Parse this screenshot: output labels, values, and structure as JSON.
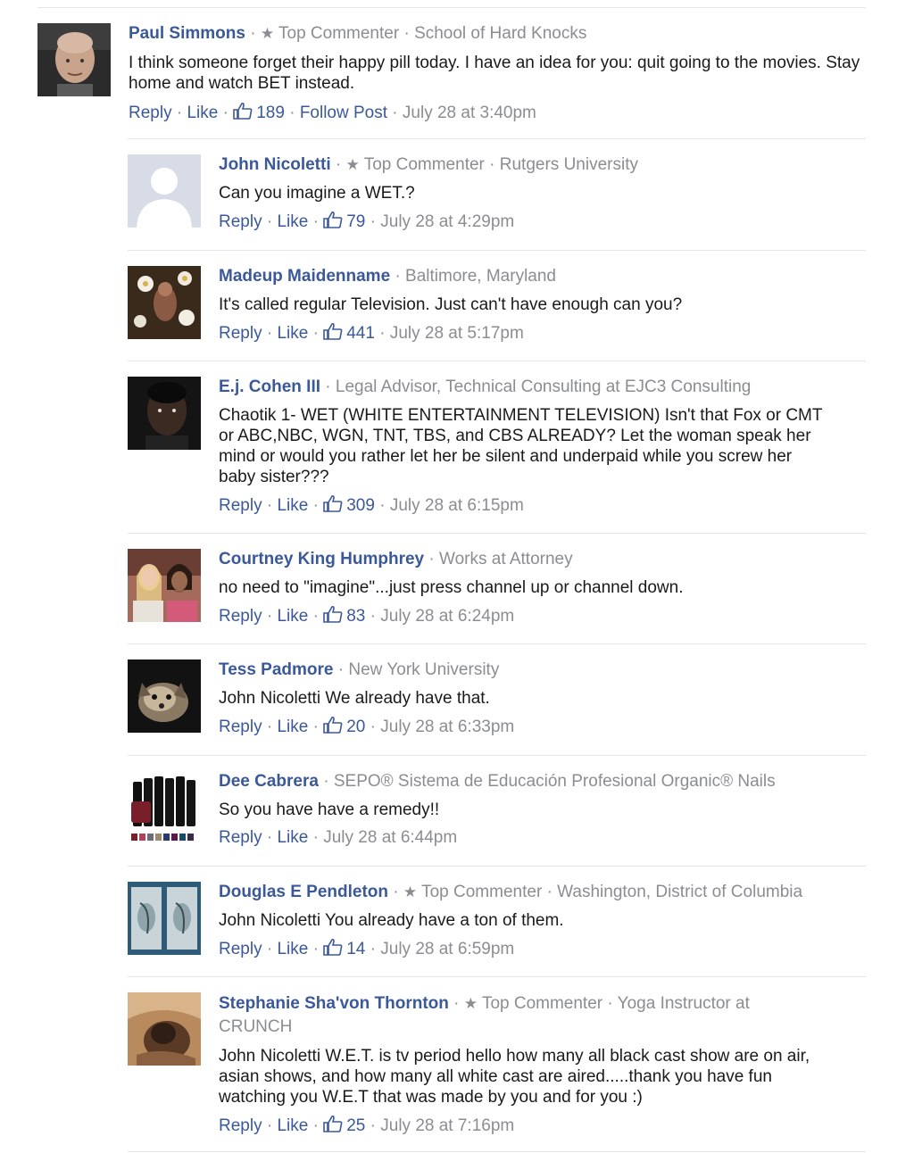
{
  "labels": {
    "reply": "Reply",
    "like": "Like",
    "follow": "Follow Post",
    "top_commenter": "Top Commenter"
  },
  "comments": [
    {
      "name": "Paul Simmons",
      "top": true,
      "meta": "School of Hard Knocks",
      "text": "I think someone forget their happy pill today. I have an idea for you: quit going to the movies. Stay home and watch BET instead.",
      "likes": "189",
      "follow": true,
      "time": "July 28 at 3:40pm",
      "avatar": "photo-bald-man"
    },
    {
      "name": "John Nicoletti",
      "top": true,
      "meta": "Rutgers University",
      "text": "Can you imagine a WET.?",
      "likes": "79",
      "time": "July 28 at 4:29pm",
      "avatar": "default-silhouette"
    },
    {
      "name": "Madeup Maidenname",
      "top": false,
      "meta": "Baltimore, Maryland",
      "text": "It's called regular Television. Just can't have enough can you?",
      "likes": "441",
      "time": "July 28 at 5:17pm",
      "avatar": "photo-flowers"
    },
    {
      "name": "E.j. Cohen III",
      "top": false,
      "meta": "Legal Advisor, Technical Consulting at EJC3 Consulting",
      "text": "Chaotik 1- WET (WHITE ENTERTAINMENT TELEVISION) Isn't that Fox or CMT or ABC,NBC, WGN, TNT, TBS, and CBS ALREADY? Let the woman speak her mind or would you rather let her be silent and underpaid while you screw her baby sister???",
      "likes": "309",
      "time": "July 28 at 6:15pm",
      "avatar": "photo-dark-portrait"
    },
    {
      "name": "Courtney King Humphrey",
      "top": false,
      "meta": "Works at Attorney",
      "text": "no need to \"imagine\"...just press channel up or channel down.",
      "likes": "83",
      "time": "July 28 at 6:24pm",
      "avatar": "photo-two-women"
    },
    {
      "name": "Tess Padmore",
      "top": false,
      "meta": "New York University",
      "text": "John Nicoletti We already have that.",
      "likes": "20",
      "time": "July 28 at 6:33pm",
      "avatar": "photo-dog"
    },
    {
      "name": "Dee Cabrera",
      "top": false,
      "meta": "SEPO® Sistema de Educación Profesional Organic® Nails",
      "text": "So you have have a remedy!!",
      "likes": "",
      "time": "July 28 at 6:44pm",
      "avatar": "photo-nail-polish"
    },
    {
      "name": "Douglas E Pendleton",
      "top": true,
      "meta": "Washington, District of Columbia",
      "text": "John Nicoletti You already have a ton of them.",
      "likes": "14",
      "time": "July 28 at 6:59pm",
      "avatar": "photo-artwork"
    },
    {
      "name": "Stephanie Sha'von Thornton",
      "top": true,
      "meta": "Yoga Instructor at CRUNCH",
      "text": "John Nicoletti W.E.T. is tv period hello how many all black cast show are on air, asian shows, and how many all white cast are aired.....thank you have fun watching you W.E.T that was made by you and for you :)",
      "likes": "25",
      "time": "July 28 at 7:16pm",
      "avatar": "photo-sepia"
    }
  ]
}
